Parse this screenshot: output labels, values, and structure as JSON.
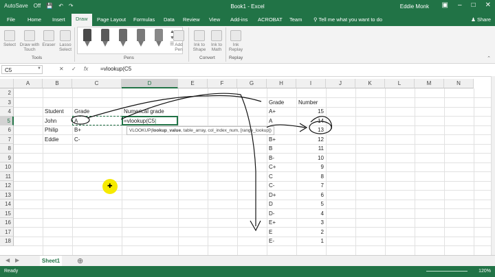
{
  "window": {
    "autosave_label": "AutoSave",
    "autosave_state": "Off",
    "title": "Book1 - Excel",
    "user": "Eddie Monk"
  },
  "tabs": [
    "File",
    "Home",
    "Insert",
    "Draw",
    "Page Layout",
    "Formulas",
    "Data",
    "Review",
    "View",
    "Add-ins",
    "ACROBAT",
    "Team"
  ],
  "active_tab": "Draw",
  "tell_me": "Tell me what you want to do",
  "share": "Share",
  "ribbon": {
    "tools": {
      "select": "Select",
      "draw_with_touch_1": "Draw with",
      "draw_with_touch_2": "Touch",
      "eraser": "Eraser",
      "lasso_1": "Lasso",
      "lasso_2": "Select",
      "label": "Tools"
    },
    "pens_label": "Pens",
    "add_pen_1": "Add",
    "add_pen_2": "Pen",
    "convert": {
      "ink_to_shape_1": "Ink to",
      "ink_to_shape_2": "Shape",
      "ink_to_math_1": "Ink to",
      "ink_to_math_2": "Math",
      "label": "Convert"
    },
    "replay": {
      "ink_replay_1": "Ink",
      "ink_replay_2": "Replay",
      "label": "Replay"
    }
  },
  "formula_bar": {
    "name_box": "C5",
    "fx": "fx",
    "content": "=vlookup(C5"
  },
  "columns": [
    "A",
    "B",
    "C",
    "D",
    "E",
    "F",
    "G",
    "H",
    "I",
    "J",
    "K",
    "L",
    "M",
    "N"
  ],
  "rows": [
    "2",
    "3",
    "4",
    "5",
    "6",
    "7",
    "8",
    "9",
    "10",
    "11",
    "12",
    "13",
    "14",
    "15",
    "16",
    "17",
    "18"
  ],
  "cells": {
    "b4": "Student",
    "c4": "Grade",
    "d4": "Numerical grade",
    "b5": "John",
    "c5": "A",
    "b6": "Philip",
    "c6": "B+",
    "b7": "Eddie",
    "c7": "C-",
    "d5_editing": "=vlookup(C5"
  },
  "formula_tooltip": {
    "fn": "VLOOKUP(",
    "arg_active": "lookup_value",
    "rest": ", table_array, col_index_num, [range_lookup])"
  },
  "lookup_table": {
    "header_grade": "Grade",
    "header_number": "Number",
    "rows": [
      {
        "grade": "A+",
        "number": "15"
      },
      {
        "grade": "A",
        "number": "14"
      },
      {
        "grade": "A-",
        "number": "13"
      },
      {
        "grade": "B+",
        "number": "12"
      },
      {
        "grade": "B",
        "number": "11"
      },
      {
        "grade": "B-",
        "number": "10"
      },
      {
        "grade": "C+",
        "number": "9"
      },
      {
        "grade": "C",
        "number": "8"
      },
      {
        "grade": "C-",
        "number": "7"
      },
      {
        "grade": "D+",
        "number": "6"
      },
      {
        "grade": "D",
        "number": "5"
      },
      {
        "grade": "D-",
        "number": "4"
      },
      {
        "grade": "E+",
        "number": "3"
      },
      {
        "grade": "E",
        "number": "2"
      },
      {
        "grade": "E-",
        "number": "1"
      }
    ]
  },
  "sheet_tab": "Sheet1",
  "status": {
    "ready": "Ready",
    "zoom": "120%"
  },
  "colors": {
    "accent": "#217346",
    "cursor_highlight": "#f6ea00"
  }
}
